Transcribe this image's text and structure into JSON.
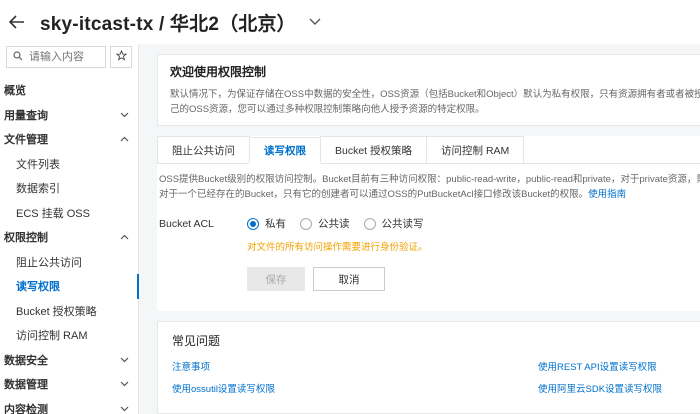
{
  "header": {
    "title": "sky-itcast-tx / 华北2（北京）"
  },
  "sidebar": {
    "search_placeholder": "请输入内容",
    "items": [
      {
        "label": "概览",
        "type": "group",
        "chevron": false
      },
      {
        "label": "用量查询",
        "type": "group",
        "chevron": "down"
      },
      {
        "label": "文件管理",
        "type": "group",
        "chevron": "up"
      },
      {
        "label": "文件列表",
        "type": "sub"
      },
      {
        "label": "数据索引",
        "type": "sub"
      },
      {
        "label": "ECS 挂载 OSS",
        "type": "sub"
      },
      {
        "label": "权限控制",
        "type": "group",
        "chevron": "up"
      },
      {
        "label": "阻止公共访问",
        "type": "sub"
      },
      {
        "label": "读写权限",
        "type": "sub",
        "active": true
      },
      {
        "label": "Bucket 授权策略",
        "type": "sub"
      },
      {
        "label": "访问控制 RAM",
        "type": "sub"
      },
      {
        "label": "数据安全",
        "type": "group",
        "chevron": "down"
      },
      {
        "label": "数据管理",
        "type": "group",
        "chevron": "down"
      },
      {
        "label": "内容检测",
        "type": "group",
        "chevron": "down"
      }
    ]
  },
  "welcome": {
    "title": "欢迎使用权限控制",
    "line1": "默认情况下，为保证存储在OSS中数据的安全性，OSS资源（包括Bucket和Object）默认为私有权限，只有资源拥有者或者被授权的用",
    "line2": "己的OSS资源，您可以通过多种权限控制策略向他人授予资源的特定权限。"
  },
  "tabs": [
    {
      "label": "阻止公共访问",
      "active": false
    },
    {
      "label": "读写权限",
      "active": true
    },
    {
      "label": "Bucket 授权策略",
      "active": false
    },
    {
      "label": "访问控制 RAM",
      "active": false
    }
  ],
  "acl_panel": {
    "desc_line1": "OSS提供Bucket级别的权限访问控制。Bucket目前有三种访问权限：public-read-write，public-read和private，对于private资源，需要获",
    "desc_line2": "对于一个已经存在的Bucket，只有它的创建者可以通过OSS的PutBucketAcl接口修改该Bucket的权限。",
    "guide_link": "使用指南",
    "acl_label": "Bucket ACL",
    "options": [
      {
        "label": "私有",
        "selected": true
      },
      {
        "label": "公共读",
        "selected": false
      },
      {
        "label": "公共读写",
        "selected": false
      }
    ],
    "warning": "对文件的所有访问操作需要进行身份验证。",
    "save_label": "保存",
    "cancel_label": "取消"
  },
  "faq": {
    "title": "常见问题",
    "links": [
      "注意事项",
      "使用REST API设置读写权限",
      "使用ossutil设置读写权限",
      "使用阿里云SDK设置读写权限"
    ]
  },
  "colors": {
    "accent": "#0070cc",
    "warning": "#f2a100"
  }
}
